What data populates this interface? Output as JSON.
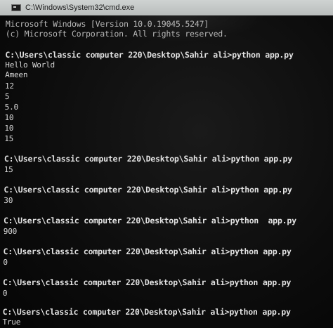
{
  "window": {
    "title": "C:\\Windows\\System32\\cmd.exe"
  },
  "console": {
    "lines": [
      "Microsoft Windows [Version 10.0.19045.5247]",
      "(c) Microsoft Corporation. All rights reserved.",
      "C:\\Users\\classic computer 220\\Desktop\\Sahir ali>python app.py",
      "Hello World",
      "Ameen",
      "12",
      "5",
      "5.0",
      "10",
      "10",
      "15",
      "C:\\Users\\classic computer 220\\Desktop\\Sahir ali>python app.py",
      "15",
      "C:\\Users\\classic computer 220\\Desktop\\Sahir ali>python app.py",
      "30",
      "C:\\Users\\classic computer 220\\Desktop\\Sahir ali>python  app.py",
      "900",
      "C:\\Users\\classic computer 220\\Desktop\\Sahir ali>python app.py",
      "0",
      "C:\\Users\\classic computer 220\\Desktop\\Sahir ali>python app.py",
      "0",
      "C:\\Users\\classic computer 220\\Desktop\\Sahir ali>python app.py",
      "True"
    ]
  }
}
